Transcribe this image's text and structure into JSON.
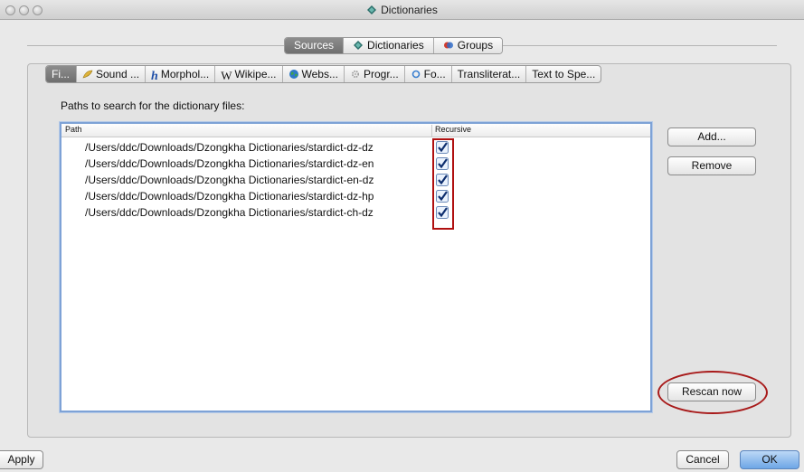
{
  "window": {
    "title": "Dictionaries"
  },
  "top_tabs": [
    {
      "label": "Sources",
      "active": true,
      "icon": ""
    },
    {
      "label": "Dictionaries",
      "active": false,
      "icon": "dictionary-icon"
    },
    {
      "label": "Groups",
      "active": false,
      "icon": "groups-icon"
    }
  ],
  "sub_tabs": [
    {
      "label": "Fi...",
      "active": true,
      "icon": ""
    },
    {
      "label": "Sound ...",
      "active": false,
      "icon": "sound-icon"
    },
    {
      "label": "Morphol...",
      "active": false,
      "icon": "morphology-icon"
    },
    {
      "label": "Wikipe...",
      "active": false,
      "icon": "wikipedia-icon"
    },
    {
      "label": "Webs...",
      "active": false,
      "icon": "globe-icon"
    },
    {
      "label": "Progr...",
      "active": false,
      "icon": "gear-icon"
    },
    {
      "label": "Fo...",
      "active": false,
      "icon": "forvo-icon"
    },
    {
      "label": "Transliterat...",
      "active": false,
      "icon": ""
    },
    {
      "label": "Text to Spe...",
      "active": false,
      "icon": ""
    }
  ],
  "paths_section": {
    "label": "Paths to search for the dictionary files:",
    "columns": {
      "path": "Path",
      "recursive": "Recursive"
    },
    "rows": [
      {
        "path": "/Users/ddc/Downloads/Dzongkha Dictionaries/stardict-dz-dz",
        "recursive": true
      },
      {
        "path": "/Users/ddc/Downloads/Dzongkha Dictionaries/stardict-dz-en",
        "recursive": true
      },
      {
        "path": "/Users/ddc/Downloads/Dzongkha Dictionaries/stardict-en-dz",
        "recursive": true
      },
      {
        "path": "/Users/ddc/Downloads/Dzongkha Dictionaries/stardict-dz-hp",
        "recursive": true
      },
      {
        "path": "/Users/ddc/Downloads/Dzongkha Dictionaries/stardict-ch-dz",
        "recursive": true
      }
    ]
  },
  "side_buttons": {
    "add": "Add...",
    "remove": "Remove",
    "rescan": "Rescan now"
  },
  "footer": {
    "apply": "Apply",
    "cancel": "Cancel",
    "ok": "OK"
  },
  "colors": {
    "annotation": "#b01010",
    "background": "#f6d9b4",
    "selection_blue": "#6ea6e6"
  }
}
